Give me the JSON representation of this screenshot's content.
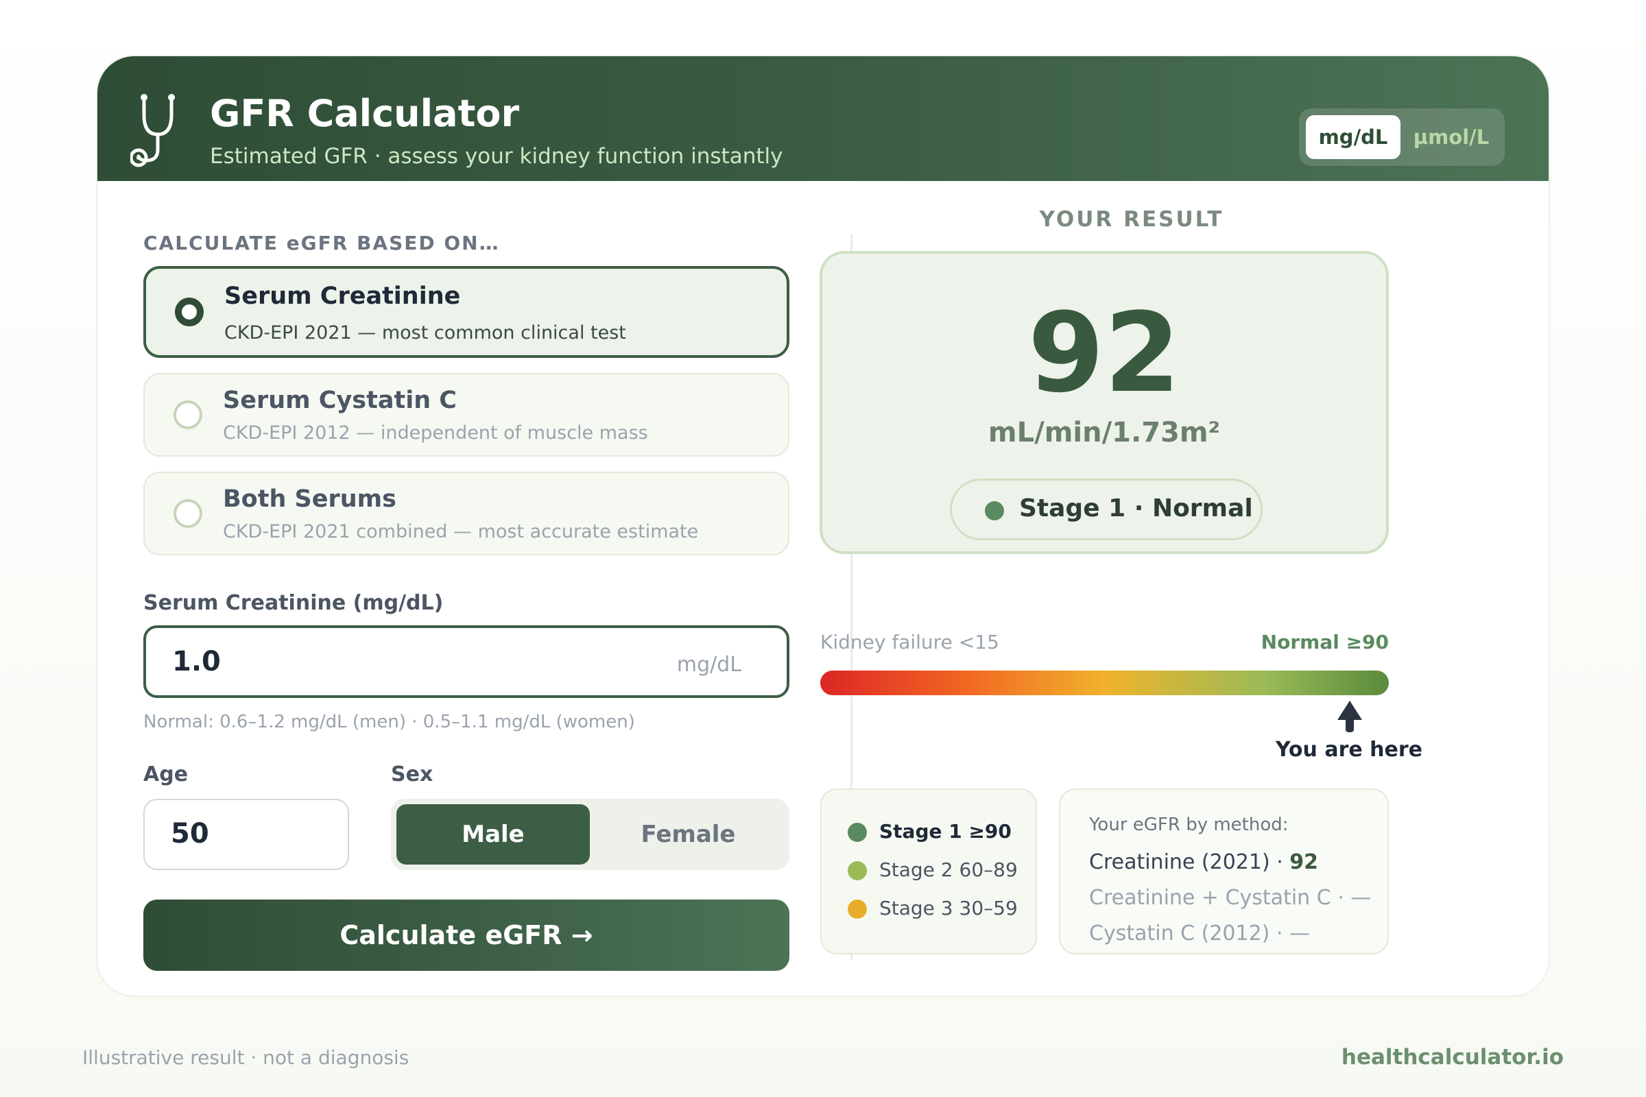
{
  "header": {
    "title": "GFR Calculator",
    "subtitle": "Estimated GFR · assess your kidney function instantly",
    "icon": "stethoscope-icon",
    "units": {
      "selected": "mg/dL",
      "options": [
        "mg/dL",
        "µmol/L"
      ]
    }
  },
  "form": {
    "section_label": "CALCULATE eGFR BASED ON…",
    "methods": [
      {
        "title": "Serum Creatinine",
        "desc": "CKD-EPI 2021 — most common clinical test",
        "selected": true
      },
      {
        "title": "Serum Cystatin C",
        "desc": "CKD-EPI 2012 — independent of muscle mass",
        "selected": false
      },
      {
        "title": "Both Serums",
        "desc": "CKD-EPI 2021 combined — most accurate estimate",
        "selected": false
      }
    ],
    "creatinine": {
      "label": "Serum Creatinine (mg/dL)",
      "value": "1.0",
      "unit": "mg/dL",
      "hint": "Normal: 0.6–1.2 mg/dL (men) · 0.5–1.1 mg/dL (women)"
    },
    "age": {
      "label": "Age",
      "value": "50"
    },
    "sex": {
      "label": "Sex",
      "options": [
        "Male",
        "Female"
      ],
      "selected": "Male"
    },
    "calculate_label": "Calculate eGFR →"
  },
  "result": {
    "label": "YOUR RESULT",
    "value": "92",
    "unit": "mL/min/1.73m²",
    "stage": "Stage 1 · Normal",
    "scale": {
      "left_label": "Kidney failure <15",
      "right_label": "Normal ≥90",
      "marker_position_fraction": 0.93,
      "marker_label": "You are here"
    },
    "legend": [
      {
        "label": "Stage 1 ≥90",
        "color": "#5a8a5f",
        "active": true
      },
      {
        "label": "Stage 2 60–89",
        "color": "#9bbb57",
        "active": false
      },
      {
        "label": "Stage 3 30–59",
        "color": "#e9ad2b",
        "active": false
      }
    ],
    "by_method": {
      "heading": "Your eGFR by method:",
      "rows": [
        {
          "name": "Creatinine (2021) · ",
          "value": "92"
        },
        {
          "name": "Creatinine + Cystatin C · ",
          "value": "—"
        },
        {
          "name": "Cystatin C (2012) · ",
          "value": "—"
        }
      ]
    }
  },
  "footer": {
    "disclaimer": "Illustrative result · not a diagnosis",
    "site": "healthcalculator.io"
  },
  "colors": {
    "brand_dark": "#2f4d36",
    "brand": "#3c5e45",
    "accent_light": "#cfe6c2"
  }
}
